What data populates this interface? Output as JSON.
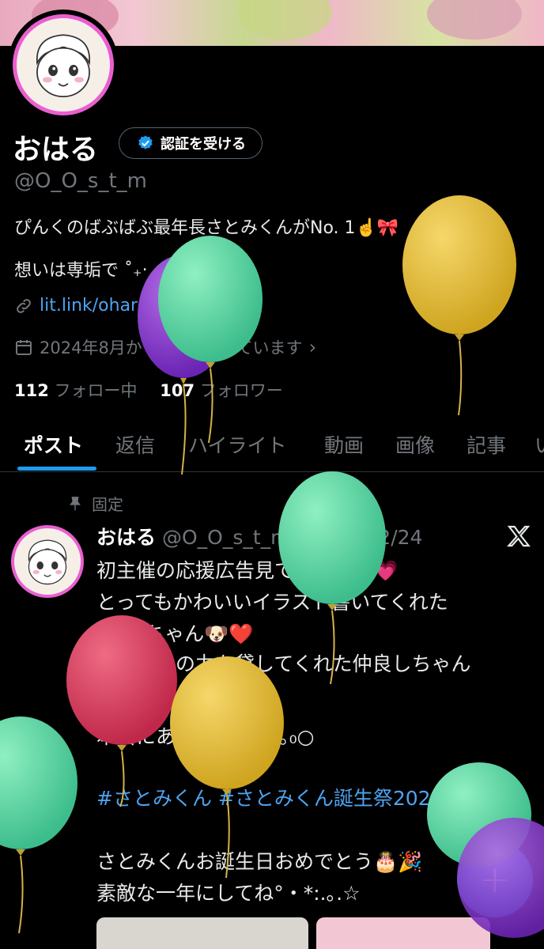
{
  "profile": {
    "name": "おはる",
    "verify_label": "認証を受ける",
    "handle": "@O_O_s_t_m",
    "bio_line1": "ぴんくのばぶばぶ最年長さとみくんがNo. 1☝️🎀",
    "bio_line2": "想いは専垢で︎︎   ︎︎︎︎˚₊‧ ͙₊.｡○❤︎ *˚",
    "link": "lit.link/oharu",
    "joined": "2024年8月からXを利用しています",
    "following_count": "112",
    "following_label": "フォロー中",
    "followers_count": "107",
    "followers_label": "フォロワー"
  },
  "tabs": [
    "ポスト",
    "返信",
    "ハイライト",
    "動画",
    "画像",
    "記事",
    "い"
  ],
  "post": {
    "pinned_label": "固定",
    "author": "おはる",
    "meta": "@O_O_s_t_m · 2026/02/24",
    "lines": [
      "初主催の応援広告見てきた〜🐱💗",
      "とってもかわいいイラスト書いてくれた",
      "yanaちゃん🐶❤️",
      "たくさんの力を貸してくれた仲良しちゃん",
      "🐷❤️",
      "本当にありがと〜🙇🏻‍♀️｡₀○",
      "#さとみくん #さとみくん誕生祭2026",
      "さとみくんお誕生日おめでとう🎂🎉",
      "素敵な一年にしてね°・*:.｡.☆"
    ]
  },
  "fab_label": "+",
  "colors": {
    "accent": "#1d9bf0",
    "link": "#4da3f0",
    "avatar_ring": "#ea5fd0",
    "muted": "#71767b"
  },
  "decoration": {
    "balloons": [
      "purple",
      "green",
      "yellow",
      "green",
      "red",
      "yellow",
      "green",
      "green",
      "purple"
    ]
  }
}
